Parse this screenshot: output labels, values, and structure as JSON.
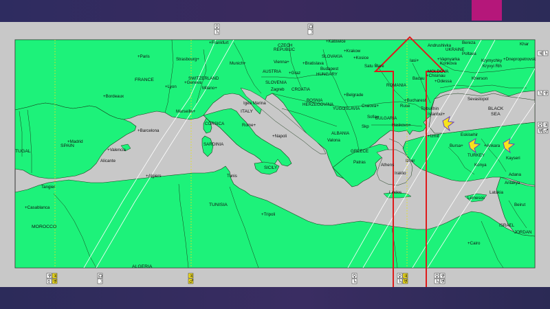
{
  "colors": {
    "land": "#1df27a",
    "sea": "#c8c8c8",
    "border": "#1a3a1a",
    "highlight": "#e0191b",
    "star": "#f7e31c",
    "star_outline": "#6a3fb8",
    "accent": "#b5177a",
    "background": "#2b2a55"
  },
  "countries": {
    "france": "FRANCE",
    "spain": "SPAIN",
    "portugal": "TUGAL",
    "morocco": "MOROCCO",
    "algeria": "ALGERIA",
    "tunisia": "TUNISIA",
    "italy": "ITALY",
    "switzerland": "SWITZERLAND",
    "austria": "AUSTRIA",
    "czech": "CZECH",
    "republic": "REPUBLIC",
    "slovakia": "SLOVAKIA",
    "hungary": "HUNGARY",
    "slovenia": "SLOVENIA",
    "croatia": "CROATIA",
    "bosnia": "BOSNIA",
    "herzegovina": "HERZEGOVINA",
    "yugoslavia": "YUGOSLAVIA",
    "albania": "ALBANIA",
    "greece": "GREECE",
    "bulgaria": "BULGARIA",
    "romania": "ROMANIA",
    "moldova": "MOLDOVA",
    "ukraine": "UKRAINE",
    "turkey": "TURKEY",
    "israel": "ISRAEL",
    "jordan": "JORDAN",
    "corsica": "CORSICA",
    "sardinia": "SARDINIA",
    "sicily": "SICILY",
    "black_sea_1": "BLACK",
    "black_sea_2": "SEA"
  },
  "cities": {
    "paris": "Paris",
    "strasbourg": "Strasbourg",
    "frankfurt": "Frankfurt",
    "munich": "Munich",
    "vienna": "Vienna",
    "bratislava": "Bratislava",
    "budapest": "Budapest",
    "katowice": "Katowice",
    "krakow": "Krakow",
    "kosice": "Kosice",
    "satu_mare": "Satu Mare",
    "iasi": "Iasi",
    "chisinau": "Chisinau",
    "odessa": "Odessa",
    "bacau": "Bacau",
    "lyon": "Lyon",
    "geneva": "Geneva",
    "milano": "Milano",
    "bordeaux": "Bordeaux",
    "marseille": "Marseille",
    "graz": "Graz",
    "zagreb": "Zagreb",
    "trieste": "Trieste",
    "belgrade": "Belgrade",
    "bucharest": "Bucharest",
    "ruse": "Ruse",
    "tolbukhin": "Tolbukhin",
    "sofia": "Sofia",
    "skopje": "Skp",
    "craiova": "Craiova",
    "haskovo": "Haskovo",
    "istanbul": "Istanbul",
    "izmit": "Izmit",
    "eskisehir": "Eskisehir",
    "ankara": "Ankara",
    "kayseri": "Kayseri",
    "konya": "Konya",
    "adana": "Adana",
    "antakya": "Antakya",
    "lemesos": "Lemesos",
    "latakia": "Latakia",
    "beirut": "Beirut",
    "sevastopol": "Sevastopol",
    "kherson": "Kherson",
    "mykolayiv": "Mykolayiv",
    "krivyi_rih": "Kryvyi Rih",
    "dnepropetrovsk": "Dnepropetrovsk",
    "kharkiv": "Khar",
    "poltava": "Poltava",
    "kremenchug": "Krymychky",
    "kirovohrad": "Kirovohrad",
    "vapnyarka": "Vapnyarka",
    "konkova": "Konkova",
    "andrushivka": "Andrushivka",
    "bereza": "Bereza",
    "barcelona": "Barcelona",
    "madrid": "Madrid",
    "valencia": "Valencia",
    "alicante": "Alicante",
    "tangier": "Tangier",
    "casablanca": "Casablanca",
    "algiers": "Algiers",
    "tunis": "Tunis",
    "tripoli": "Tripoli",
    "cairo": "Cairo",
    "rome": "Rome",
    "napoli": "Napoli",
    "igea_marina": "Igea Marina",
    "split": "Split",
    "valona": "Valona",
    "larisa": "Larisa",
    "patras": "Patras",
    "athens": "Athens",
    "izmir": "Izmir",
    "bursa": "Bursa",
    "iraklio": "Iraklio",
    "lindos": "Lindos",
    "kosovo": "Kosovo",
    "grosseto": "Grosseto",
    "mostar": "Mostar",
    "timisoara": "Timisoara",
    "brasov": "Brasov",
    "ukraine_kyiv": "Kyiv"
  },
  "planet_markers": {
    "top_1": [
      "♀",
      "♄"
    ],
    "top_2": [
      "☊",
      "☽"
    ],
    "right_1": [
      "♃",
      "♄"
    ],
    "right_2": [
      "♄",
      "♆"
    ],
    "right_3": [
      "♀",
      "♃"
    ],
    "right_4": [
      "♅",
      "♂"
    ],
    "bottom_1": [
      "♆",
      "♃",
      "☿",
      "♅"
    ],
    "bottom_2": [
      "☊",
      "☽"
    ],
    "bottom_3": [
      "♃",
      "♂"
    ],
    "bottom_4": [
      "♀",
      "♄"
    ],
    "bottom_5": [
      "♀",
      "♃",
      "♄",
      "♅"
    ],
    "bottom_6": [
      "♀",
      "♆",
      "♄",
      "♅"
    ]
  }
}
